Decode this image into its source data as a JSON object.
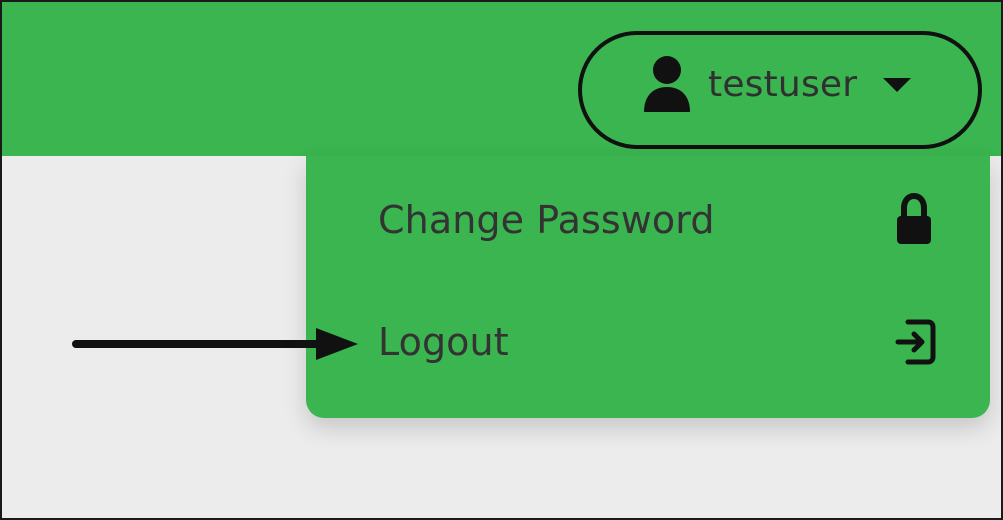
{
  "header": {
    "username": "testuser",
    "user_icon": "user-icon",
    "dropdown_icon": "chevron-down-icon"
  },
  "dropdown": {
    "items": [
      {
        "label": "Change Password",
        "icon": "lock-icon"
      },
      {
        "label": "Logout",
        "icon": "logout-icon"
      }
    ]
  },
  "colors": {
    "brand_green": "#3ab54f",
    "background": "#ececec",
    "text_dark": "#333333",
    "annotation": "#111111"
  }
}
